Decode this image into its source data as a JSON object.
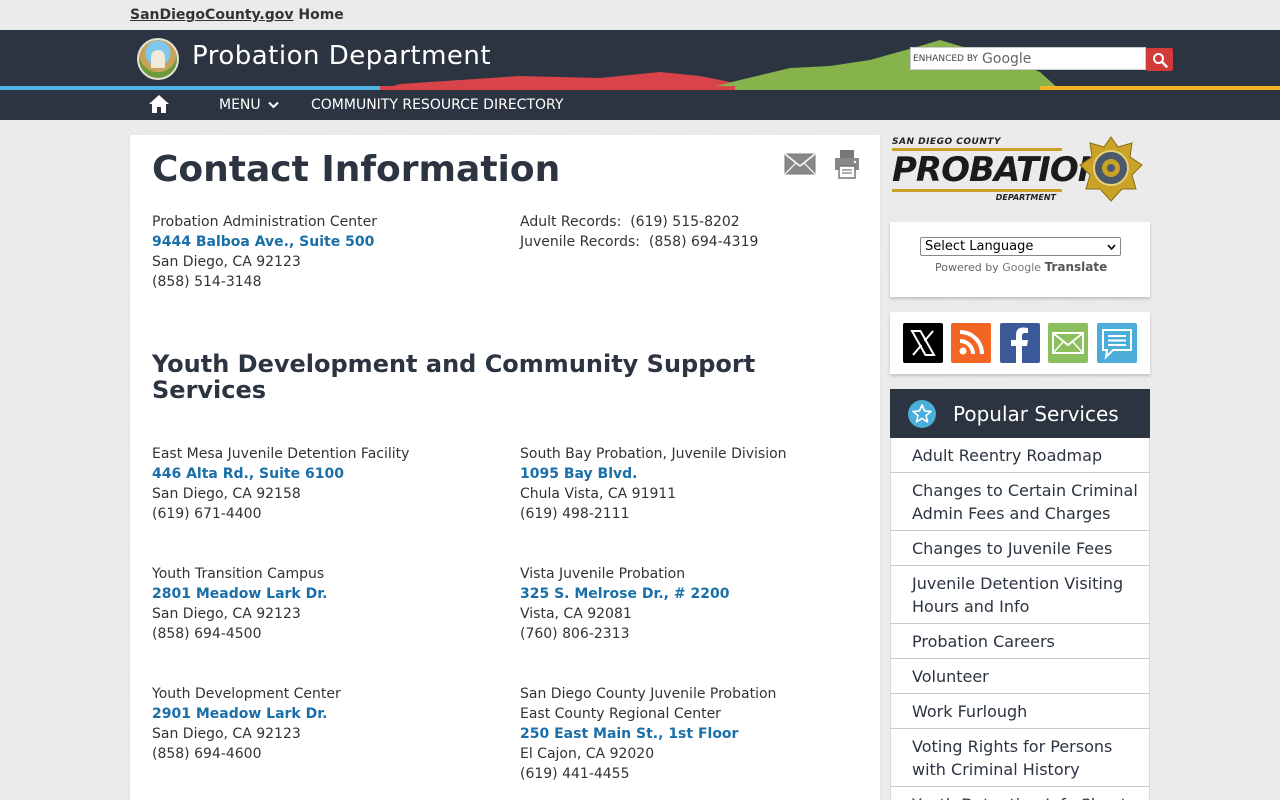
{
  "utility": {
    "site": "SanDiegoCounty.gov",
    "home": "Home"
  },
  "header": {
    "title": "Probation Department",
    "search_enhanced": "ENHANCED BY",
    "search_google": "Google"
  },
  "nav": {
    "menu": "MENU",
    "resource_directory": "COMMUNITY RESOURCE DIRECTORY"
  },
  "main": {
    "title": "Contact Information",
    "admin": {
      "name": "Probation Administration Center",
      "address": "9444 Balboa Ave., Suite 500",
      "city": "San Diego, CA 92123",
      "phone": "(858) 514-3148"
    },
    "records": {
      "adult": "Adult Records:  (619) 515-8202",
      "juvenile": "Juvenile Records:  (858) 694-4319"
    },
    "section_title": "Youth Development and Community Support Services",
    "facilities": [
      {
        "name": "East Mesa Juvenile Detention Facility",
        "address": "446 Alta Rd., Suite 6100",
        "city": "San Diego, CA 92158",
        "phone": "(619) 671-4400"
      },
      {
        "name": "South Bay Probation, Juvenile Division",
        "address": "1095 Bay Blvd.",
        "city": "Chula Vista, CA 91911",
        "phone": "(619) 498-2111"
      },
      {
        "name": "Youth Transition Campus",
        "address": "2801 Meadow Lark Dr.",
        "city": "San Diego, CA 92123",
        "phone": "(858) 694-4500"
      },
      {
        "name": "Vista Juvenile Probation",
        "address": "325 S. Melrose Dr., # 2200",
        "city": "Vista, CA 92081",
        "phone": "(760) 806-2313"
      },
      {
        "name": "Youth Development Center",
        "address": "2901 Meadow Lark Dr.",
        "city": "San Diego, CA 92123",
        "phone": "(858) 694-4600"
      },
      {
        "name": "San Diego County Juvenile Probation",
        "name2": "East County Regional Center",
        "address": "250 East Main St., 1st Floor",
        "city": "El Cajon, CA 92020",
        "phone": "(619) 441-4455"
      }
    ]
  },
  "brand": {
    "small": "SAN DIEGO COUNTY",
    "big": "PROBATION",
    "dept": "DEPARTMENT"
  },
  "translate": {
    "select_label": "Select Language",
    "powered_by": "Powered by",
    "google": "Google",
    "translate": "Translate"
  },
  "social": [
    {
      "icon": "x-icon",
      "color": "#000000"
    },
    {
      "icon": "rss-icon",
      "color": "#f26522"
    },
    {
      "icon": "facebook-icon",
      "color": "#3b5998"
    },
    {
      "icon": "email-icon",
      "color": "#8cbf5e"
    },
    {
      "icon": "comment-icon",
      "color": "#4aaed9"
    }
  ],
  "popular": {
    "title": "Popular Services",
    "items": [
      "Adult Reentry Roadmap",
      "Changes to Certain Criminal Admin Fees and Charges",
      "Changes to Juvenile Fees",
      "Juvenile Detention Visiting Hours and Info",
      "Probation Careers",
      "Volunteer",
      "Work Furlough",
      "Voting Rights for Persons with Criminal History",
      "Youth Detention Info Sheet"
    ]
  },
  "colors": {
    "navy": "#2b3440",
    "link_blue": "#1a6fa8",
    "stripe_blue": "#4db6e8",
    "stripe_red": "#d9444a",
    "stripe_green": "#86b34b",
    "stripe_yellow": "#f3b32b",
    "search_red": "#d33a3a"
  }
}
